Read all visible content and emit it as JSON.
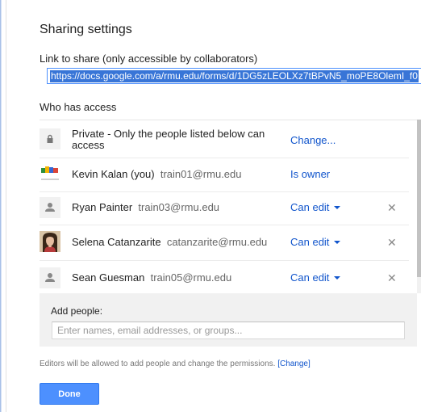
{
  "dialog": {
    "title": "Sharing settings",
    "link_label": "Link to share (only accessible by collaborators)",
    "link_value": "https://docs.google.com/a/rmu.edu/forms/d/1DG5zLEOLXz7tBPvN5_moPE8OlemI_f0",
    "who_has_access_label": "Who has access"
  },
  "access": {
    "privacy": {
      "icon": "lock-icon",
      "text": "Private - Only the people listed below can access",
      "action": "Change..."
    },
    "people": [
      {
        "name": "Kevin Kalan (you)",
        "email": "train01@rmu.edu",
        "permission": "Is owner",
        "avatar": "kevin-avatar",
        "removable": false,
        "dropdown": false
      },
      {
        "name": "Ryan Painter",
        "email": "train03@rmu.edu",
        "permission": "Can edit",
        "avatar": "person-icon",
        "removable": true,
        "dropdown": true
      },
      {
        "name": "Selena Catanzarite",
        "email": "catanzarite@rmu.edu",
        "permission": "Can edit",
        "avatar": "selena-avatar",
        "removable": true,
        "dropdown": true
      },
      {
        "name": "Sean Guesman",
        "email": "train05@rmu.edu",
        "permission": "Can edit",
        "avatar": "person-icon",
        "removable": true,
        "dropdown": true
      }
    ],
    "remove_glyph": "✕"
  },
  "add_people": {
    "label": "Add people:",
    "placeholder": "Enter names, email addresses, or groups..."
  },
  "footer": {
    "editors_note": "Editors will be allowed to add people and change the permissions.",
    "change_link": "[Change]",
    "done_label": "Done"
  },
  "colors": {
    "link_blue": "#1155cc",
    "button_blue": "#4d90fe",
    "selection_blue": "#3875d7"
  }
}
